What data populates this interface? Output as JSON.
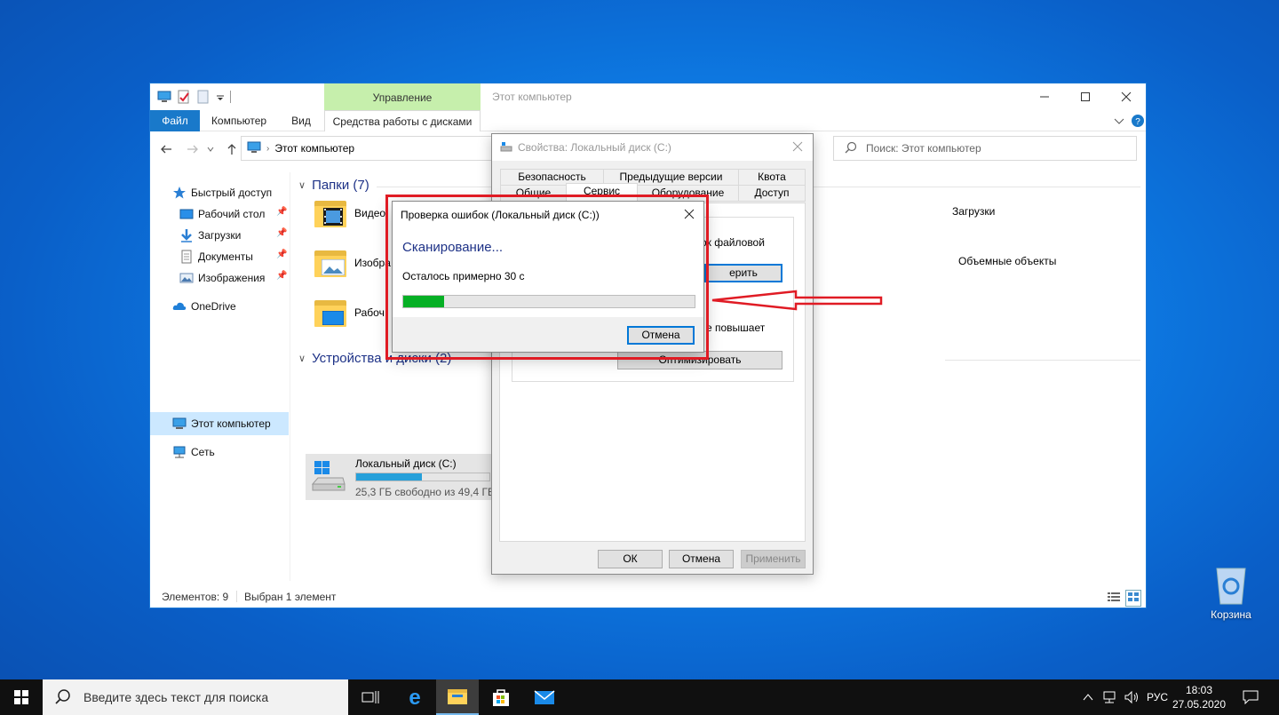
{
  "explorer": {
    "title": "Этот компьютер",
    "context_tab": "Управление",
    "ribbon_tabs": [
      "Файл",
      "Компьютер",
      "Вид",
      "Средства работы с дисками"
    ],
    "address": "Этот компьютер",
    "search_placeholder": "Поиск: Этот компьютер",
    "nav": {
      "quick_access": "Быстрый доступ",
      "desktop": "Рабочий стол",
      "downloads": "Загрузки",
      "documents": "Документы",
      "pictures": "Изображения",
      "onedrive": "OneDrive",
      "this_pc": "Этот компьютер",
      "network": "Сеть"
    },
    "folders_header": "Папки (7)",
    "folders": {
      "video": "Видео",
      "pictures": "Изобра",
      "desktop": "Рабоч",
      "downloads": "Загрузки",
      "objects3d": "Объемные объекты"
    },
    "devices_header": "Устройства и диски (2)",
    "drive": {
      "name": "Локальный диск (C:)",
      "free_text": "25,3 ГБ свободно из 49,4 ГБ",
      "used_fraction": 0.49
    },
    "status": {
      "items": "Элементов: 9",
      "selected": "Выбран 1 элемент"
    }
  },
  "properties": {
    "title": "Свойства: Локальный диск (C:)",
    "tabs_row1": [
      "Безопасность",
      "Предыдущие версии",
      "Квота"
    ],
    "tabs_row2": [
      "Общие",
      "Сервис",
      "Оборудование",
      "Доступ"
    ],
    "partial_text1": "ок файловой",
    "partial_button": "ерить",
    "partial_text2": "е повышает",
    "optimize_button": "Оптимизировать",
    "ok": "ОК",
    "cancel": "Отмена",
    "apply": "Применить"
  },
  "check_dialog": {
    "title": "Проверка ошибок (Локальный диск (C:))",
    "heading": "Сканирование...",
    "remaining": "Осталось примерно 30 с",
    "progress_fraction": 0.14,
    "cancel": "Отмена"
  },
  "desktop": {
    "recycle_bin": "Корзина"
  },
  "taskbar": {
    "search_placeholder": "Введите здесь текст для поиска",
    "language": "РУС",
    "time": "18:03",
    "date": "27.05.2020"
  },
  "colors": {
    "accent": "#1979ca",
    "progress": "#06b025",
    "highlight": "#e01b24",
    "context_tab": "#c6efac"
  }
}
